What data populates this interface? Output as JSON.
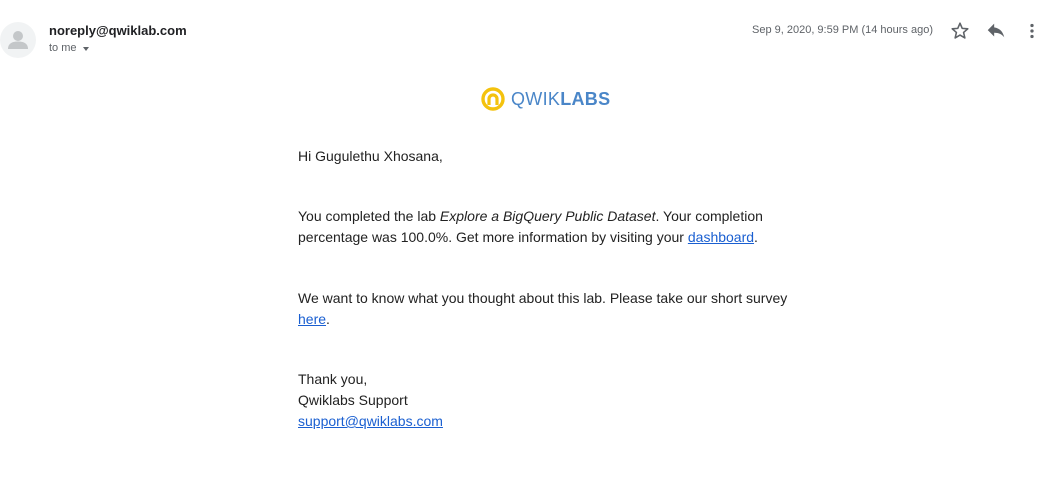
{
  "header": {
    "sender": "noreply@qwiklab.com",
    "recipient": "to me",
    "timestamp": "Sep 9, 2020, 9:59 PM (14 hours ago)",
    "icons": [
      "avatar-icon",
      "star-icon",
      "reply-icon",
      "more-vert-icon"
    ]
  },
  "logo": {
    "wordmark_light": "QWIK",
    "wordmark_bold": "LABS",
    "icon_color": "#f4c20d",
    "text_color": "#4a86c8"
  },
  "message": {
    "greeting": "Hi Gugulethu Xhosana,",
    "lab_text_before": "You completed the lab ",
    "lab_name": "Explore a BigQuery Public Dataset",
    "lab_text_after": ". Your completion percentage was 100.0%. Get more information by visiting your ",
    "dashboard_link": "dashboard",
    "lab_text_end": ".",
    "survey_text_before": "We want to know what you thought about this lab. Please take our short survey ",
    "survey_link": "here",
    "survey_text_end": ".",
    "signoff": "Thank you,",
    "signature": "Qwiklabs Support",
    "support_email": "support@qwiklabs.com"
  },
  "colors": {
    "link": "#1a5fd1",
    "secondary_text": "#5f6368"
  }
}
